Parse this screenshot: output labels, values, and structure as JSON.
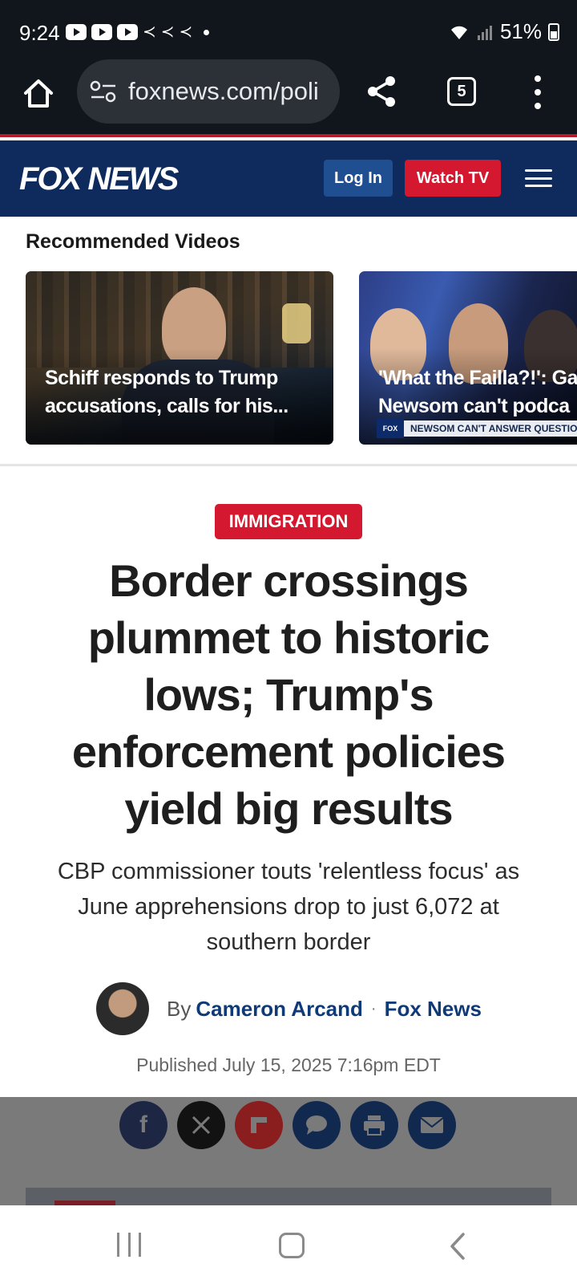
{
  "status_bar": {
    "time": "9:24",
    "battery": "51%"
  },
  "browser": {
    "url": "foxnews.com/poli",
    "tab_count": "5"
  },
  "site_header": {
    "logo": "FOX NEWS",
    "login_label": "Log In",
    "watch_label": "Watch TV"
  },
  "recommended": {
    "title": "Recommended Videos",
    "videos": [
      {
        "title_line1": "Schiff responds to Trump",
        "title_line2": "accusations, calls for his..."
      },
      {
        "title_line1": "'What the Failla?!': Ga",
        "title_line2": "Newsom can't podca",
        "ticker": "NEWSOM CAN'T ANSWER QUESTION ON K",
        "ticker_logo": "FOX NEWS LIVE"
      }
    ]
  },
  "article": {
    "category": "IMMIGRATION",
    "headline": "Border crossings plummet to historic lows; Trump's enforcement policies yield big results",
    "subheadline": "CBP commissioner touts 'relentless focus' as June apprehensions drop to just 6,072 at southern border",
    "by_prefix": "By",
    "author": "Cameron Arcand",
    "separator": "·",
    "outlet": "Fox News",
    "published": "Published July 15, 2025 7:16pm EDT"
  },
  "share_buttons": [
    "facebook-icon",
    "x-icon",
    "flipboard-icon",
    "comment-icon",
    "print-icon",
    "email-icon"
  ],
  "colors": {
    "fox_blue": "#0f2a5c",
    "fox_red": "#d3182f",
    "link_blue": "#0f3a78"
  }
}
